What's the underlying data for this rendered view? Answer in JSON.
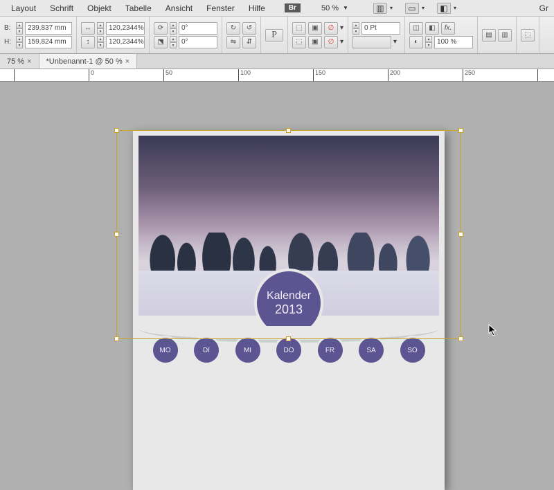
{
  "menubar": {
    "items": [
      "Layout",
      "Schrift",
      "Objekt",
      "Tabelle",
      "Ansicht",
      "Fenster",
      "Hilfe"
    ],
    "br_label": "Br",
    "zoom": "50 %",
    "right_label": "Gr"
  },
  "controls": {
    "width_label": "B:",
    "width_value": "239,837 mm",
    "height_label": "H:",
    "height_value": "159,824 mm",
    "scale_a": "120,2344%",
    "scale_b": "120,2344%",
    "rotate_a": "0°",
    "rotate_b": "0°",
    "stroke_pt": "0 Pt",
    "opacity": "100 %"
  },
  "tabs": {
    "t0": {
      "label": "75 %"
    },
    "t1": {
      "label": "*Unbenannt-1 @ 50 %"
    }
  },
  "ruler": {
    "marks": [
      "0",
      "50",
      "100",
      "150",
      "200",
      "250"
    ]
  },
  "calendar": {
    "title": "Kalender",
    "year": "2013",
    "days": [
      "MO",
      "DI",
      "MI",
      "DO",
      "FR",
      "SA",
      "SO"
    ]
  }
}
